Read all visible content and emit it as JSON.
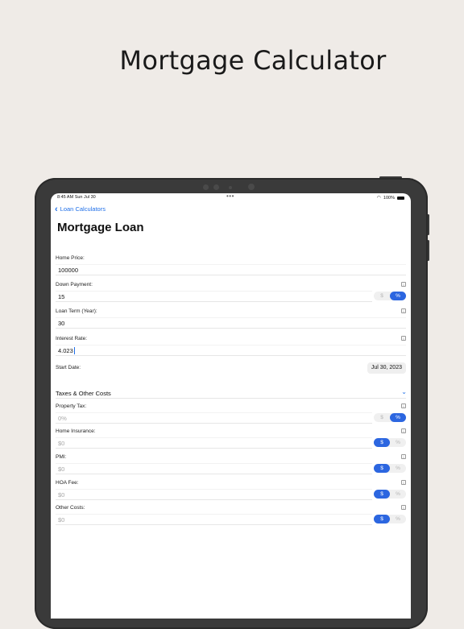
{
  "promo": {
    "title": "Mortgage Calculator"
  },
  "status_bar": {
    "time": "8:45 AM  Sun Jul 30",
    "dots": "•••",
    "battery": "100%"
  },
  "nav": {
    "back_label": "Loan Calculators",
    "page_title": "Mortgage Loan"
  },
  "fields": {
    "home_price": {
      "label": "Home Price:",
      "value": "100000"
    },
    "down_payment": {
      "label": "Down Payment:",
      "value": "15",
      "options": [
        "$",
        "%"
      ],
      "selected": "%"
    },
    "loan_term": {
      "label": "Loan Term (Year):",
      "value": "30"
    },
    "interest_rate": {
      "label": "Interest Rate:",
      "value": "4.023"
    },
    "start_date": {
      "label": "Start Date:",
      "value": "Jul 30, 2023"
    }
  },
  "taxes_section": {
    "title": "Taxes & Other Costs",
    "items": {
      "property_tax": {
        "label": "Property Tax:",
        "placeholder": "0%",
        "options": [
          "$",
          "%"
        ],
        "selected": "%"
      },
      "home_insurance": {
        "label": "Home Insurance:",
        "placeholder": "$0",
        "options": [
          "$",
          "%"
        ],
        "selected": "$"
      },
      "pmi": {
        "label": "PMI:",
        "placeholder": "$0",
        "options": [
          "$",
          "%"
        ],
        "selected": "$"
      },
      "hoa_fee": {
        "label": "HOA Fee:",
        "placeholder": "$0",
        "options": [
          "$",
          "%"
        ],
        "selected": "$"
      },
      "other_costs": {
        "label": "Other Costs:",
        "placeholder": "$0",
        "options": [
          "$",
          "%"
        ],
        "selected": "$"
      }
    }
  },
  "icons": {
    "info": "info-icon",
    "back": "chevron-left-icon",
    "expand": "chevron-down-icon"
  },
  "colors": {
    "accent": "#2c66e0",
    "link": "#1f6fe8",
    "background": "#efebe7",
    "device": "#3a3a3a"
  }
}
